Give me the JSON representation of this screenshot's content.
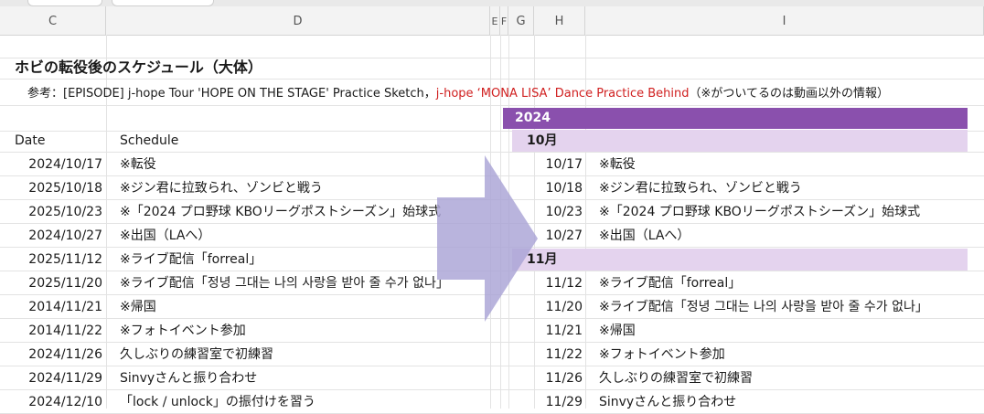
{
  "columns": {
    "C": "C",
    "D": "D",
    "E": "E",
    "F": "F",
    "G": "G",
    "H": "H",
    "I": "I"
  },
  "title": "ホビの転役後のスケジュール（大体）",
  "reference": {
    "prefix": "参考：[EPISODE] j-hope Tour 'HOPE ON THE STAGE' Practice Sketch，",
    "highlight": "j-hope ‘MONA LISA’ Dance Practice Behind",
    "suffix": "（※がついてるのは動画以外の情報）"
  },
  "colors": {
    "year_band": "#8a50ad",
    "month_band": "#e4d3ee",
    "arrow": "#a9a3d6"
  },
  "left_table": {
    "header_date": "Date",
    "header_schedule": "Schedule",
    "rows": [
      {
        "date": "2024/10/17",
        "schedule": "※転役"
      },
      {
        "date": "2025/10/18",
        "schedule": "※ジン君に拉致られ、ゾンビと戦う"
      },
      {
        "date": "2025/10/23",
        "schedule": "※「2024 プロ野球 KBOリーグポストシーズン」始球式"
      },
      {
        "date": "2024/10/27",
        "schedule": "※出国（LAへ）"
      },
      {
        "date": "2025/11/12",
        "schedule": "※ライブ配信「forreal」"
      },
      {
        "date": "2025/11/20",
        "schedule": "※ライブ配信「정녕 그대는 나의 사랑을 받아 줄 수가 없나」"
      },
      {
        "date": "2014/11/21",
        "schedule": "※帰国"
      },
      {
        "date": "2014/11/22",
        "schedule": "※フォトイベント参加"
      },
      {
        "date": "2024/11/26",
        "schedule": "久しぶりの練習室で初練習"
      },
      {
        "date": "2024/11/29",
        "schedule": "Sinvyさんと振り合わせ"
      },
      {
        "date": "2024/12/10",
        "schedule": "「lock / unlock」の振付けを習う"
      }
    ]
  },
  "right_table": {
    "year": "2024",
    "rows": [
      {
        "type": "month",
        "label": "10月"
      },
      {
        "type": "item",
        "date": "10/17",
        "schedule": "※転役"
      },
      {
        "type": "item",
        "date": "10/18",
        "schedule": "※ジン君に拉致られ、ゾンビと戦う"
      },
      {
        "type": "item",
        "date": "10/23",
        "schedule": "※「2024 プロ野球 KBOリーグポストシーズン」始球式"
      },
      {
        "type": "item",
        "date": "10/27",
        "schedule": "※出国（LAへ）"
      },
      {
        "type": "month",
        "label": "11月"
      },
      {
        "type": "item",
        "date": "11/12",
        "schedule": "※ライブ配信「forreal」"
      },
      {
        "type": "item",
        "date": "11/20",
        "schedule": "※ライブ配信「정녕 그대는 나의 사랑을 받아 줄 수가 없나」"
      },
      {
        "type": "item",
        "date": "11/21",
        "schedule": "※帰国"
      },
      {
        "type": "item",
        "date": "11/22",
        "schedule": "※フォトイベント参加"
      },
      {
        "type": "item",
        "date": "11/26",
        "schedule": "久しぶりの練習室で初練習"
      },
      {
        "type": "item",
        "date": "11/29",
        "schedule": "Sinvyさんと振り合わせ"
      }
    ]
  }
}
